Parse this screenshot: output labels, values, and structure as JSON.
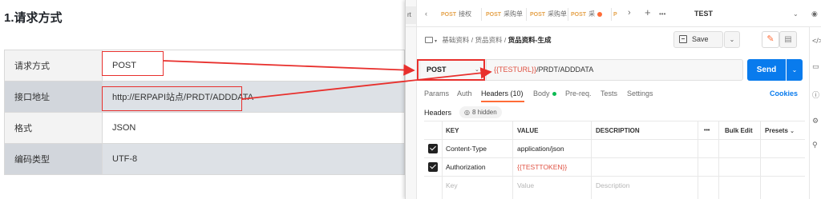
{
  "doc": {
    "title": "1.请求方式",
    "rows": [
      {
        "key": "请求方式",
        "value": "POST"
      },
      {
        "key": "接口地址",
        "value": "http://ERPAPI站点/PRDT/ADDDATA"
      },
      {
        "key": "格式",
        "value": "JSON"
      },
      {
        "key": "编码类型",
        "value": "UTF-8"
      }
    ]
  },
  "postman": {
    "tabs": [
      {
        "method": "POST",
        "label": "接权"
      },
      {
        "method": "POST",
        "label": "采购单"
      },
      {
        "method": "POST",
        "label": "采购单"
      },
      {
        "method": "POST",
        "label": "采"
      },
      {
        "method": "P",
        "label": ""
      }
    ],
    "tab_overflow": "•••",
    "add_tab": "+",
    "environment": "TEST",
    "left_tab_letter": "rt",
    "breadcrumb": {
      "items": [
        "基础资料",
        "货品资料"
      ],
      "current": "货品资料-生成",
      "separator": "/"
    },
    "save_label": "Save",
    "request": {
      "method": "POST",
      "url_variable": "{{TESTURL}}",
      "url_path": "/PRDT/ADDDATA",
      "send_label": "Send"
    },
    "request_tabs": [
      "Params",
      "Auth",
      "Headers (10)",
      "Body",
      "Pre-req.",
      "Tests",
      "Settings"
    ],
    "cookies_label": "Cookies",
    "headers_label": "Headers",
    "hidden_label": "8 hidden",
    "table": {
      "columns": {
        "key": "KEY",
        "value": "VALUE",
        "description": "DESCRIPTION",
        "more": "•••",
        "bulk_edit": "Bulk Edit",
        "presets": "Presets"
      },
      "rows": [
        {
          "key": "Content-Type",
          "value": "application/json",
          "description": ""
        },
        {
          "key": "Authorization",
          "value": "{{TESTTOKEN}}",
          "description": ""
        }
      ],
      "placeholders": {
        "key": "Key",
        "value": "Value",
        "description": "Description"
      }
    }
  },
  "colors": {
    "annotation": "#e8302d",
    "send": "#097bed",
    "postman_orange": "#ff6c37",
    "variable": "#e05243"
  }
}
